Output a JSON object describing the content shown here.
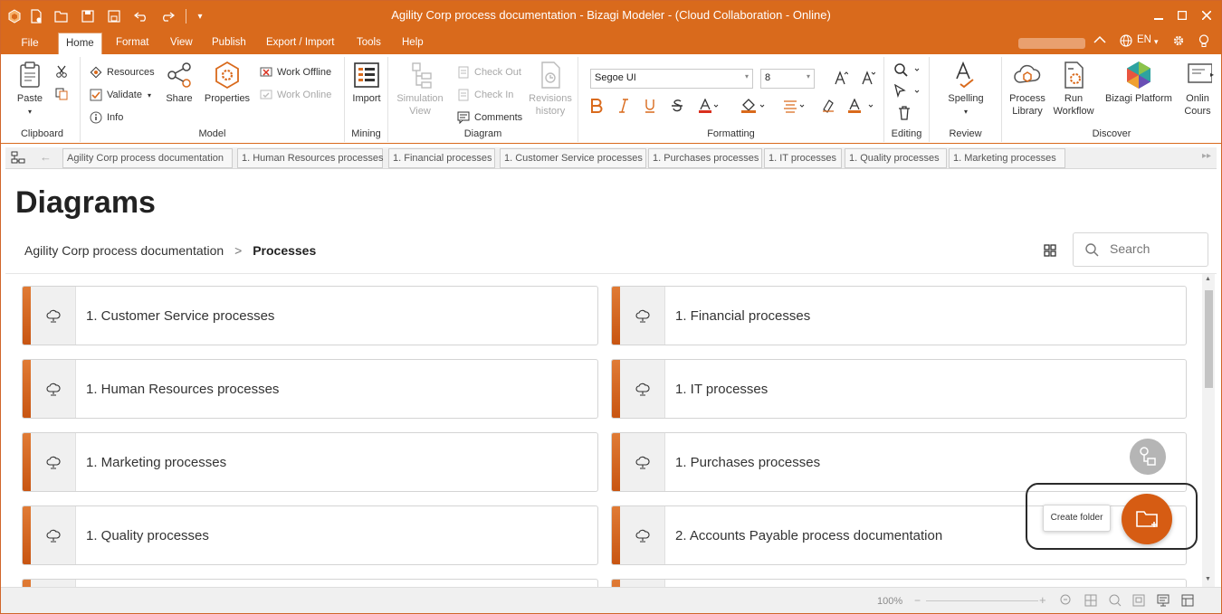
{
  "window": {
    "title": "Agility Corp process documentation - Bizagi Modeler - (Cloud Collaboration - Online)"
  },
  "ribbon_tabs": {
    "file": "File",
    "tabs": [
      "Home",
      "Format",
      "View",
      "Publish",
      "Export / Import",
      "Tools",
      "Help"
    ],
    "language": "EN"
  },
  "ribbon": {
    "clipboard": {
      "label": "Clipboard",
      "paste": "Paste"
    },
    "model": {
      "label": "Model",
      "resources": "Resources",
      "validate": "Validate",
      "info": "Info",
      "share": "Share",
      "properties": "Properties",
      "work_offline": "Work Offline",
      "work_online": "Work Online"
    },
    "mining": {
      "label": "Mining",
      "import": "Import"
    },
    "diagram": {
      "label": "Diagram",
      "simulation_view_1": "Simulation",
      "simulation_view_2": "View",
      "check_out": "Check Out",
      "check_in": "Check In",
      "comments": "Comments",
      "revisions_1": "Revisions",
      "revisions_2": "history"
    },
    "formatting": {
      "label": "Formatting",
      "font": "Segoe UI",
      "size": "8"
    },
    "editing": {
      "label": "Editing"
    },
    "review": {
      "label": "Review",
      "spelling": "Spelling"
    },
    "discover": {
      "label": "Discover",
      "process_library_1": "Process",
      "process_library_2": "Library",
      "run_workflow_1": "Run",
      "run_workflow_2": "Workflow",
      "bizagi_platform": "Bizagi Platform",
      "online_courses_1": "Onlin",
      "online_courses_2": "Cours"
    }
  },
  "doc_tabs": [
    "Agility Corp process documentation",
    "1. Human Resources processes",
    "1. Financial processes",
    "1. Customer Service processes",
    "1. Purchases processes",
    "1. IT processes",
    "1. Quality processes",
    "1. Marketing processes"
  ],
  "page": {
    "title": "Diagrams",
    "breadcrumb_root": "Agility Corp process documentation",
    "breadcrumb_sep": ">",
    "breadcrumb_current": "Processes",
    "search_placeholder": "Search"
  },
  "cards": [
    "1. Customer Service processes",
    "1. Financial processes",
    "1. Human Resources processes",
    "1. IT processes",
    "1. Marketing processes",
    "1. Purchases processes",
    "1. Quality processes",
    "2. Accounts Payable process documentation"
  ],
  "fab": {
    "tooltip": "Create folder"
  },
  "status": {
    "zoom": "100%"
  },
  "colors": {
    "brand": "#d96a1c",
    "fab": "#d65c13",
    "accent": "#e07b35"
  }
}
